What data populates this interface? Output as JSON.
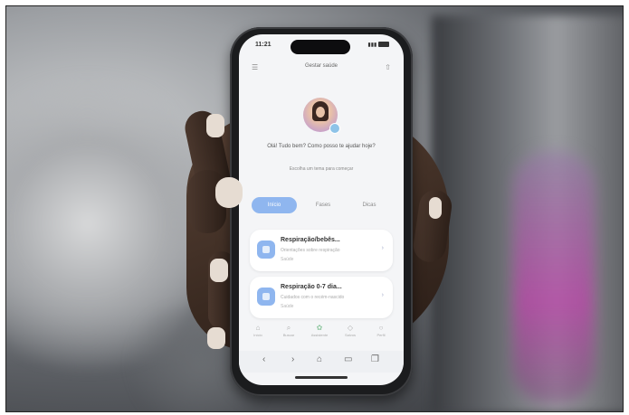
{
  "status_bar": {
    "time": "11:21",
    "signal": "▮▮▮"
  },
  "topbar": {
    "title": "Gestar saúde"
  },
  "greeting": {
    "line": "Olá! Tudo bem? Como posso te ajudar hoje?",
    "sub": "Escolha um tema para começar"
  },
  "tabs": [
    {
      "label": "Início",
      "active": true
    },
    {
      "label": "Fases"
    },
    {
      "label": "Dicas"
    }
  ],
  "cards": [
    {
      "title": "Respiração/bebês...",
      "sub": "Orientações sobre respiração",
      "meta": "Saúde"
    },
    {
      "title": "Respiração 0-7 dia...",
      "sub": "Cuidados com o recém-nascido",
      "meta": "Saúde"
    }
  ],
  "bottom_nav": [
    "Início",
    "Buscar",
    "Assistente",
    "Salvos",
    "Perfil"
  ],
  "colors": {
    "accent": "#8fb6ef",
    "screen_bg": "#f4f5f7"
  },
  "icons": [
    "menu-icon",
    "share-icon",
    "back-icon",
    "forward-icon",
    "home-icon",
    "tabs-icon",
    "copy-icon"
  ]
}
